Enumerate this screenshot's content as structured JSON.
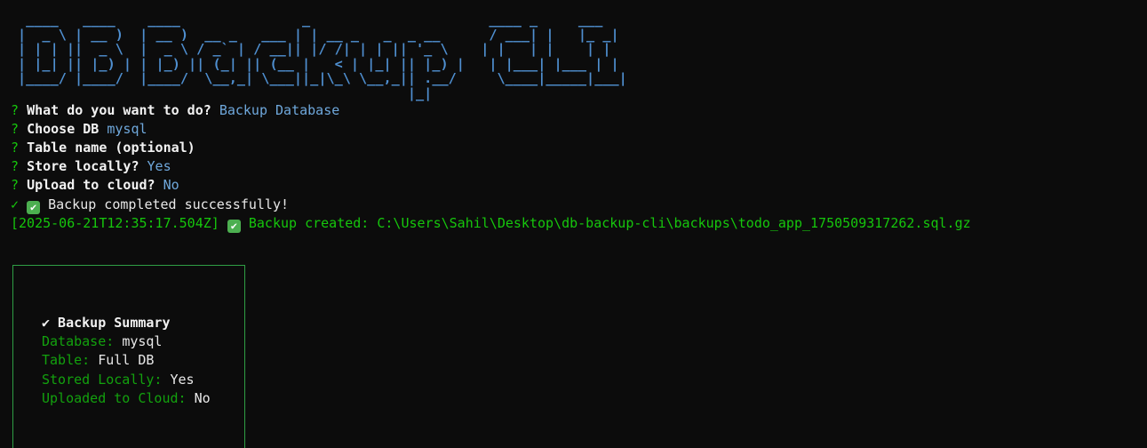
{
  "banner": {
    "ascii_art": " ____   ____    ____               _                      ____ _     ___ \n|  _ \\ | __ )  | __ )  __ _   ___ | | __ _   _  _ __      / ___| |   |_ _|\n| | | ||  _ \\  |  _ \\ / _` | / __|| |/ /| | | || '_ \\    | |   | |    | | \n| |_| || |_) | | |_) || (_| || (__ |   < | |_| || |_) |   | |___| |___ | | \n|____/ |____/  |____/  \\__,_| \\___||_|\\_\\ \\__,_|| .__/     \\____|_____|___|\n                                                |_|                        ",
    "text": "DB Backup CLI"
  },
  "prompts": [
    {
      "mark": "?",
      "question": "What do you want to do?",
      "answer": "Backup Database"
    },
    {
      "mark": "?",
      "question": "Choose DB",
      "answer": "mysql"
    },
    {
      "mark": "?",
      "question": "Table name (optional)",
      "answer": ""
    },
    {
      "mark": "?",
      "question": "Store locally?",
      "answer": "Yes"
    },
    {
      "mark": "?",
      "question": "Upload to cloud?",
      "answer": "No"
    }
  ],
  "status": {
    "check_mark": "✓",
    "emoji_check": "✔",
    "message": "Backup completed successfully!"
  },
  "log": {
    "timestamp": "[2025-06-21T12:35:17.504Z]",
    "emoji_check": "✔",
    "message": "Backup created: C:\\Users\\Sahil\\Desktop\\db-backup-cli\\backups\\todo_app_1750509317262.sql.gz"
  },
  "summary": {
    "title": "✔ Backup Summary",
    "rows": [
      {
        "key": "Database:",
        "value": "mysql"
      },
      {
        "key": "Table:",
        "value": "Full DB"
      },
      {
        "key": "Stored Locally:",
        "value": "Yes"
      },
      {
        "key": "Uploaded to Cloud:",
        "value": "No"
      }
    ]
  },
  "colors": {
    "background": "#0c0c0c",
    "banner": "#4f8fd0",
    "prompt_mark": "#16c60c",
    "answer": "#6fa8dc",
    "summary_border": "#2f9e44"
  }
}
